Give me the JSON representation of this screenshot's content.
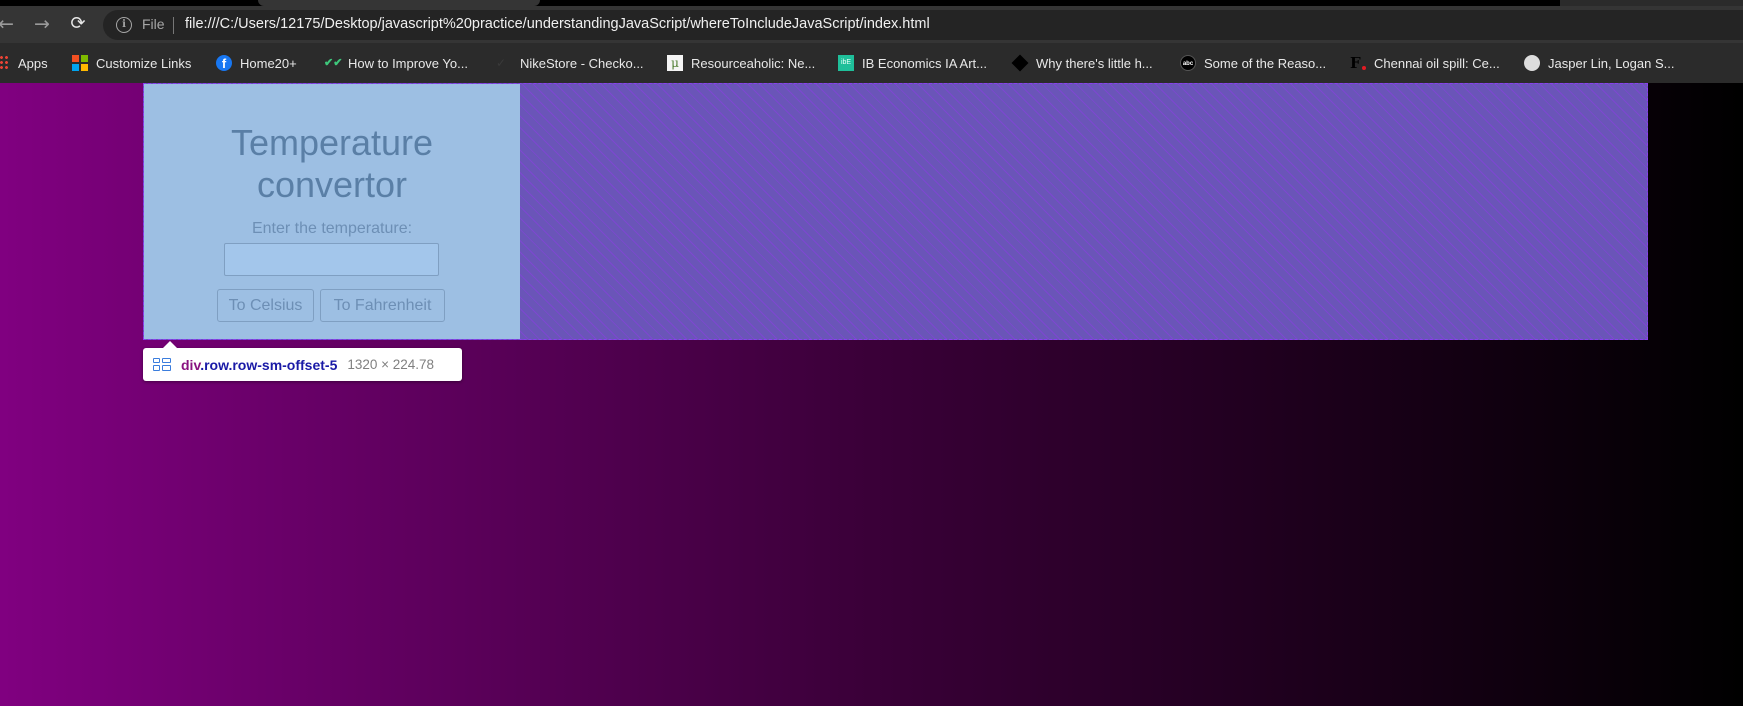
{
  "browser": {
    "nav": {
      "back_icon": "←",
      "forward_icon": "→",
      "reload_icon": "⟳"
    },
    "omnibox": {
      "info_icon": "i",
      "scheme_label": "File",
      "url": "file:///C:/Users/12175/Desktop/javascript%20practice/understandingJavaScript/whereToIncludeJavaScript/index.html"
    },
    "bookmarks": [
      {
        "label": "Apps",
        "icon": "apps-grid-icon"
      },
      {
        "label": "Customize Links",
        "icon": "microsoft-logo-icon"
      },
      {
        "label": "Home20+",
        "icon": "facebook-icon",
        "glyph": "f"
      },
      {
        "label": "How to Improve Yo...",
        "icon": "double-check-icon",
        "glyph": "✔✔"
      },
      {
        "label": "NikeStore - Checko...",
        "icon": "nike-swoosh-icon",
        "glyph": "✓"
      },
      {
        "label": "Resourceaholic: Ne...",
        "icon": "mu-icon",
        "glyph": "μ"
      },
      {
        "label": "IB Economics IA Art...",
        "icon": "ibe-icon",
        "glyph": "ibE"
      },
      {
        "label": "Why there's little h...",
        "icon": "diamond-icon",
        "glyph": ""
      },
      {
        "label": "Some of the Reaso...",
        "icon": "abc-news-icon",
        "glyph": "abc"
      },
      {
        "label": "Chennai oil spill: Ce...",
        "icon": "f-logo-icon",
        "glyph": "F"
      },
      {
        "label": "Jasper Lin, Logan S...",
        "icon": "globe-icon",
        "glyph": "🌐"
      }
    ]
  },
  "page": {
    "background_gradient": [
      "#800080",
      "#000000"
    ],
    "converter": {
      "title_line1": "Temperature",
      "title_line2": "convertor",
      "input_label": "Enter the temperature:",
      "input_value": "",
      "to_celsius_label": "To Celsius",
      "to_fahrenheit_label": "To Fahrenheit"
    },
    "devtools_tooltip": {
      "tag": "div",
      "classes": ".row.row-sm-offset-5",
      "dimensions": "1320 × 224.78"
    }
  }
}
